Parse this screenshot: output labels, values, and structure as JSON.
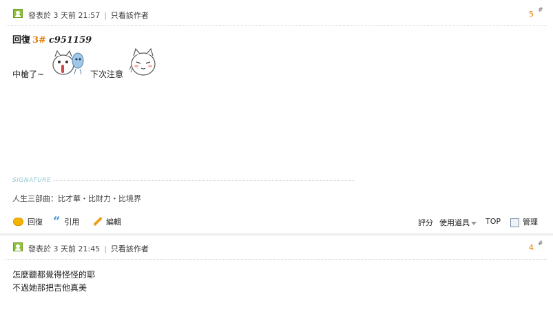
{
  "posts": [
    {
      "meta": {
        "posted_at": "發表於 3 天前 21:57",
        "only_author": "只看該作者"
      },
      "floor": "5",
      "floor_mark": "#",
      "reply": {
        "label": "回復",
        "number": "3#",
        "user": "c951159"
      },
      "messages": [
        "中槍了~",
        "下次注意"
      ],
      "signature": {
        "label": "SIGNATURE",
        "text": "人生三部曲：比才華・比財力・比境界"
      },
      "actions": {
        "reply": "回復",
        "quote": "引用",
        "edit": "編輯"
      },
      "tools": {
        "rate": "評分",
        "use_item": "使用道具",
        "top": "TOP",
        "manage": "管理"
      }
    },
    {
      "meta": {
        "posted_at": "發表於 3 天前 21:45",
        "only_author": "只看該作者"
      },
      "floor": "4",
      "floor_mark": "#",
      "lines": [
        "怎麼聽都覺得怪怪的耶",
        "不過她那把吉他真美"
      ]
    }
  ],
  "icons": {
    "author": "user-icon",
    "reply": "speech-bubble-icon",
    "quote": "quote-icon",
    "edit": "pencil-icon",
    "manage": "checkbox-icon"
  },
  "colors": {
    "floor_number": "#e07b00",
    "author_icon": "#8fc23a",
    "signature_label": "#8fcbd6",
    "quote_icon": "#3b8fd6"
  }
}
